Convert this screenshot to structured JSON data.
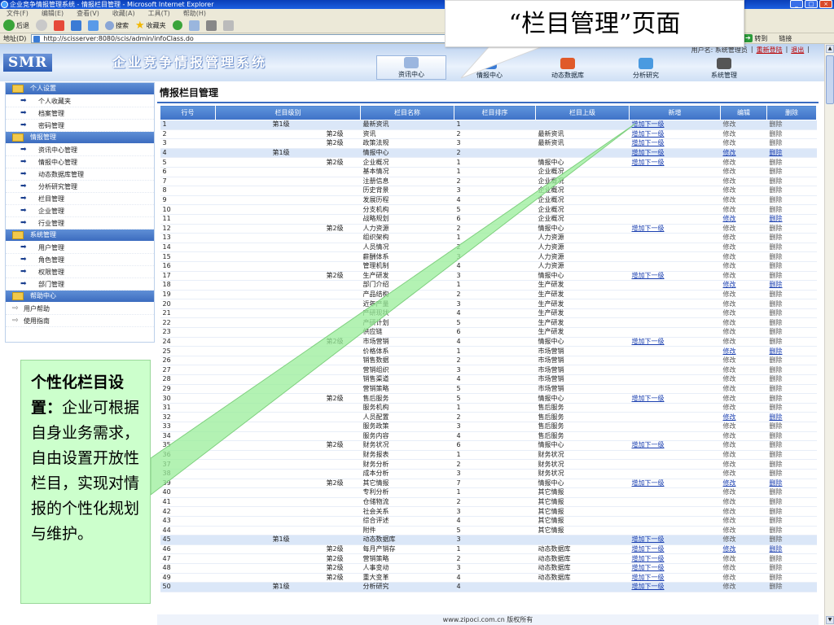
{
  "browser": {
    "window_title": "企业竞争情报管理系统 - 情报栏目管理 - Microsoft Internet Explorer",
    "menu": [
      "文件(F)",
      "编辑(E)",
      "查看(V)",
      "收藏(A)",
      "工具(T)",
      "帮助(H)"
    ],
    "back_label": "后退",
    "search_label": "搜索",
    "favorites_label": "收藏夹",
    "address_label": "地址(D)",
    "address_value": "http://scisserver:8080/scis/admin/infoClass.do",
    "go_label": "转到",
    "links_label": "链接"
  },
  "header": {
    "logo": "SMR",
    "system_title": "企业竞争情报管理系统",
    "user_label": "用户名: 系统管理员",
    "relogin": "重新登陆",
    "logout": "退出",
    "nav": [
      {
        "label": "资讯中心",
        "color": "#9bb6df"
      },
      {
        "label": "情报中心",
        "color": "#3a7bd5"
      },
      {
        "label": "动态数据库",
        "color": "#e05a2a"
      },
      {
        "label": "分析研究",
        "color": "#4a9ae0"
      },
      {
        "label": "系统管理",
        "color": "#555555"
      }
    ]
  },
  "callout_title": "“栏目管理”页面",
  "sidebar": {
    "sections": [
      {
        "title": "个人设置",
        "hollow": false,
        "items": [
          "个人收藏夹",
          "档案管理",
          "密码管理"
        ]
      },
      {
        "title": "情报管理",
        "hollow": false,
        "items": [
          "资讯中心管理",
          "情报中心管理",
          "动态数据库管理",
          "分析研究管理",
          "栏目管理",
          "企业管理",
          "行业管理"
        ]
      },
      {
        "title": "系统管理",
        "hollow": false,
        "items": [
          "用户管理",
          "角色管理",
          "权限管理",
          "部门管理"
        ]
      },
      {
        "title": "帮助中心",
        "hollow": true,
        "items": [
          "用户帮助",
          "使用指南"
        ]
      }
    ]
  },
  "main": {
    "page_title": "情报栏目管理",
    "columns": [
      "行号",
      "栏目级别",
      "栏目名称",
      "栏目排序",
      "栏目上级",
      "新增",
      "编辑",
      "删除"
    ],
    "add_label": "增加下一级",
    "edit_label": "修改",
    "delete_label": "删除",
    "rows": [
      [
        1,
        1,
        "最新资讯",
        1,
        ""
      ],
      [
        2,
        2,
        "资讯",
        2,
        "最新资讯"
      ],
      [
        3,
        2,
        "政策法规",
        3,
        "最新资讯"
      ],
      [
        4,
        1,
        "情报中心",
        2,
        ""
      ],
      [
        5,
        2,
        "企业概况",
        1,
        "情报中心"
      ],
      [
        6,
        3,
        "基本情况",
        1,
        "企业概况"
      ],
      [
        7,
        3,
        "注册信息",
        2,
        "企业概况"
      ],
      [
        8,
        3,
        "历史背景",
        3,
        "企业概况"
      ],
      [
        9,
        3,
        "发展历程",
        4,
        "企业概况"
      ],
      [
        10,
        3,
        "分支机构",
        5,
        "企业概况"
      ],
      [
        11,
        3,
        "战略规划",
        6,
        "企业概况"
      ],
      [
        12,
        2,
        "人力资源",
        2,
        "情报中心"
      ],
      [
        13,
        3,
        "组织架构",
        1,
        "人力资源"
      ],
      [
        14,
        3,
        "人员情况",
        2,
        "人力资源"
      ],
      [
        15,
        3,
        "薪酬体系",
        3,
        "人力资源"
      ],
      [
        16,
        3,
        "管理机制",
        4,
        "人力资源"
      ],
      [
        17,
        2,
        "生产研发",
        3,
        "情报中心"
      ],
      [
        18,
        3,
        "部门介绍",
        1,
        "生产研发"
      ],
      [
        19,
        3,
        "产品结构",
        2,
        "生产研发"
      ],
      [
        20,
        3,
        "近年产量",
        3,
        "生产研发"
      ],
      [
        21,
        3,
        "产研现状",
        4,
        "生产研发"
      ],
      [
        22,
        3,
        "产研计划",
        5,
        "生产研发"
      ],
      [
        23,
        3,
        "供应链",
        6,
        "生产研发"
      ],
      [
        24,
        2,
        "市场营销",
        4,
        "情报中心"
      ],
      [
        25,
        3,
        "价格体系",
        1,
        "市场营销"
      ],
      [
        26,
        3,
        "销售数据",
        2,
        "市场营销"
      ],
      [
        27,
        3,
        "营销组织",
        3,
        "市场营销"
      ],
      [
        28,
        3,
        "销售渠道",
        4,
        "市场营销"
      ],
      [
        29,
        3,
        "营销策略",
        5,
        "市场营销"
      ],
      [
        30,
        2,
        "售后服务",
        5,
        "情报中心"
      ],
      [
        31,
        3,
        "服务机构",
        1,
        "售后服务"
      ],
      [
        32,
        3,
        "人员配置",
        2,
        "售后服务"
      ],
      [
        33,
        3,
        "服务政策",
        3,
        "售后服务"
      ],
      [
        34,
        3,
        "服务内容",
        4,
        "售后服务"
      ],
      [
        35,
        2,
        "财务状况",
        6,
        "情报中心"
      ],
      [
        36,
        3,
        "财务报表",
        1,
        "财务状况"
      ],
      [
        37,
        3,
        "财务分析",
        2,
        "财务状况"
      ],
      [
        38,
        3,
        "成本分析",
        3,
        "财务状况"
      ],
      [
        39,
        2,
        "其它情报",
        7,
        "情报中心"
      ],
      [
        40,
        3,
        "专利分析",
        1,
        "其它情报"
      ],
      [
        41,
        3,
        "仓储物流",
        2,
        "其它情报"
      ],
      [
        42,
        3,
        "社会关系",
        3,
        "其它情报"
      ],
      [
        43,
        3,
        "综合评述",
        4,
        "其它情报"
      ],
      [
        44,
        3,
        "附件",
        5,
        "其它情报"
      ],
      [
        45,
        1,
        "动态数据库",
        3,
        ""
      ],
      [
        46,
        2,
        "每月产销存",
        1,
        "动态数据库"
      ],
      [
        47,
        2,
        "营销策略",
        2,
        "动态数据库"
      ],
      [
        48,
        2,
        "人事变动",
        3,
        "动态数据库"
      ],
      [
        49,
        2,
        "重大变革",
        4,
        "动态数据库"
      ],
      [
        50,
        1,
        "分析研究",
        4,
        ""
      ]
    ],
    "level_labels": {
      "1": "第1级",
      "2": "第2级",
      "3": "第3级"
    }
  },
  "footer": "www.zipoci.com.cn 版权所有",
  "annotation": {
    "bold_text": "个性化栏目设置：",
    "body_text": "企业可根据自身业务需求，自由设置开放性栏目，实现对情报的个性化规划与维护。"
  }
}
